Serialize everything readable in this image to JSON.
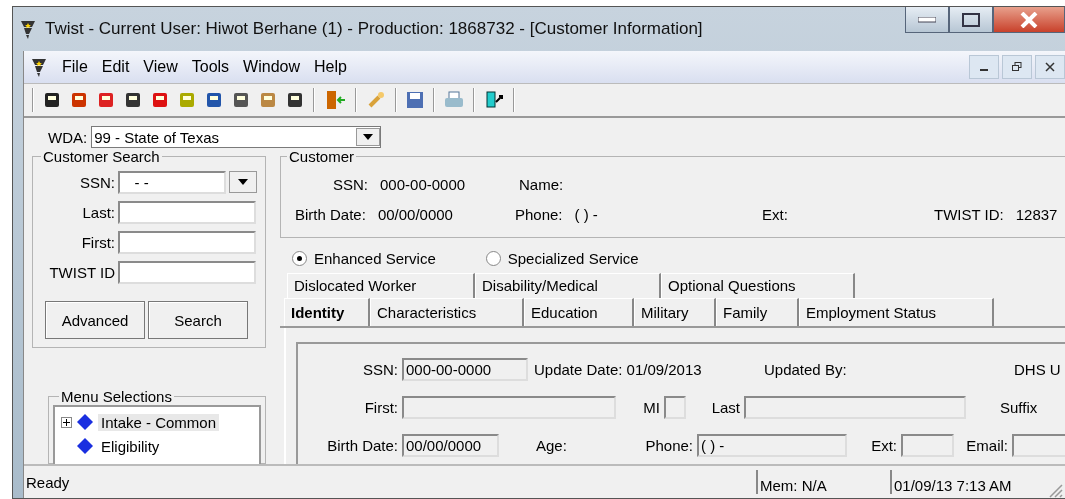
{
  "window": {
    "title": "Twist - Current User: Hiwot Berhane (1) - Production: 1868732 - [Customer Information]"
  },
  "menu": [
    "File",
    "Edit",
    "View",
    "Tools",
    "Window",
    "Help"
  ],
  "wda": {
    "label": "WDA:",
    "value": "99 - State of Texas"
  },
  "customer_search": {
    "title": "Customer Search",
    "fields": [
      {
        "label": "SSN:",
        "value": "-  -",
        "kind": "combo"
      },
      {
        "label": "Last:",
        "kind": "text"
      },
      {
        "label": "First:",
        "kind": "text"
      },
      {
        "label": "TWIST ID",
        "kind": "text"
      }
    ],
    "buttons": [
      "Advanced",
      "Search"
    ]
  },
  "menu_selections": {
    "title": "Menu Selections",
    "items": [
      {
        "label": "Intake - Common",
        "selected": true,
        "has_children": true
      },
      {
        "label": "Eligibility",
        "selected": false,
        "has_children": false
      }
    ]
  },
  "customer": {
    "title": "Customer",
    "rows": [
      [
        {
          "label": "SSN:",
          "value": "000-00-0000"
        },
        {
          "label": "Name:"
        }
      ],
      [
        {
          "label": "Birth Date:",
          "value": "00/00/0000"
        },
        {
          "label": "Phone:",
          "value": "(   )    -"
        },
        {
          "label": "Ext:"
        },
        {
          "label": "TWIST ID:",
          "value": "12837"
        }
      ]
    ]
  },
  "service_options": [
    {
      "label": "Enhanced Service",
      "selected": true
    },
    {
      "label": "Specialized Service",
      "selected": false
    }
  ],
  "tab_rows": [
    [
      {
        "label": "Dislocated Worker",
        "selected": false
      },
      {
        "label": "Disability/Medical",
        "selected": false
      },
      {
        "label": "Optional Questions",
        "selected": false
      }
    ],
    [
      {
        "label": "Identity",
        "selected": true
      },
      {
        "label": "Characteristics",
        "selected": false
      },
      {
        "label": "Education",
        "selected": false
      },
      {
        "label": "Military",
        "selected": false
      },
      {
        "label": "Family",
        "selected": false
      },
      {
        "label": "Employment Status",
        "selected": false
      }
    ]
  ],
  "identity": [
    [
      {
        "kind": "field",
        "label": "SSN:",
        "value": "000-00-0000"
      },
      {
        "kind": "text",
        "label": "Update Date: 01/09/2013"
      },
      {
        "kind": "text",
        "label": "Updated By:"
      },
      {
        "kind": "text",
        "label": "DHS U"
      }
    ],
    [
      {
        "kind": "field",
        "label": "First:"
      },
      {
        "kind": "field",
        "label": "MI"
      },
      {
        "kind": "field",
        "label": "Last"
      },
      {
        "kind": "text",
        "label": "Suffix"
      }
    ],
    [
      {
        "kind": "field",
        "label": "Birth Date:",
        "value": "00/00/0000"
      },
      {
        "kind": "text",
        "label": "Age:"
      },
      {
        "kind": "field",
        "label": "Phone:",
        "value": "(  )   -"
      },
      {
        "kind": "field",
        "label": "Ext:"
      },
      {
        "kind": "field",
        "label": "Email:"
      }
    ]
  ],
  "status_bar": {
    "message": "Ready",
    "memory": "Mem: N/A",
    "datetime": "01/09/13 7:13 AM"
  }
}
